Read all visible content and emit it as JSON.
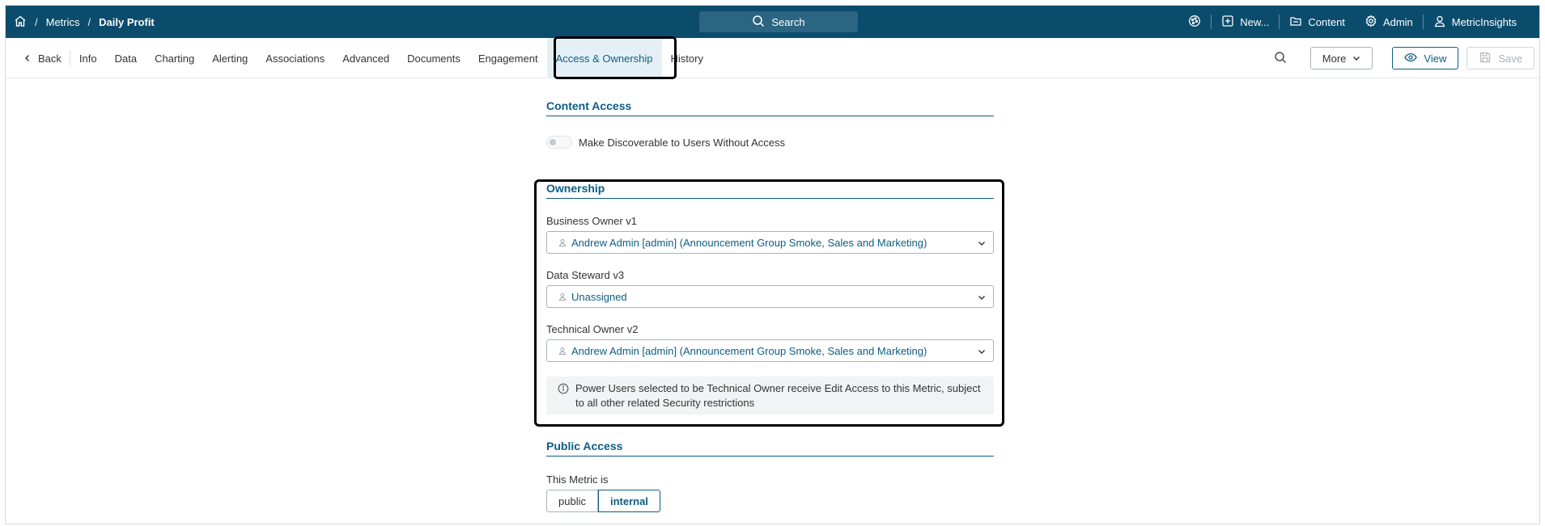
{
  "breadcrumb": {
    "items": [
      "Metrics",
      "Daily Profit"
    ],
    "separator": "/"
  },
  "search": {
    "label": "Search"
  },
  "top_nav": {
    "new_label": "New...",
    "content_label": "Content",
    "admin_label": "Admin",
    "user_label": "MetricInsights"
  },
  "tabs": {
    "back_label": "Back",
    "items": [
      "Info",
      "Data",
      "Charting",
      "Alerting",
      "Associations",
      "Advanced",
      "Documents",
      "Engagement",
      "Access & Ownership",
      "History"
    ],
    "active": "Access & Ownership"
  },
  "toolbar": {
    "more_label": "More",
    "view_label": "View",
    "save_label": "Save"
  },
  "content_access": {
    "title": "Content Access",
    "toggle_label": "Make Discoverable to Users Without Access",
    "toggle_on": false
  },
  "ownership": {
    "title": "Ownership",
    "fields": [
      {
        "label": "Business Owner v1",
        "value": "Andrew Admin [admin] (Announcement Group Smoke, Sales and Marketing)"
      },
      {
        "label": "Data Steward v3",
        "value": "Unassigned"
      },
      {
        "label": "Technical Owner v2",
        "value": "Andrew Admin [admin] (Announcement Group Smoke, Sales and Marketing)"
      }
    ],
    "info_line1": "Power Users selected to be Technical Owner receive Edit Access to this Metric, subject",
    "info_line2": "to all other related Security restrictions"
  },
  "public_access": {
    "title": "Public Access",
    "label": "This Metric is",
    "options": [
      "public",
      "internal"
    ],
    "selected": "internal"
  },
  "colors": {
    "header_bg": "#0b4c6c",
    "accent": "#0b5d84",
    "active_tab_bg": "#e5f0f6"
  }
}
